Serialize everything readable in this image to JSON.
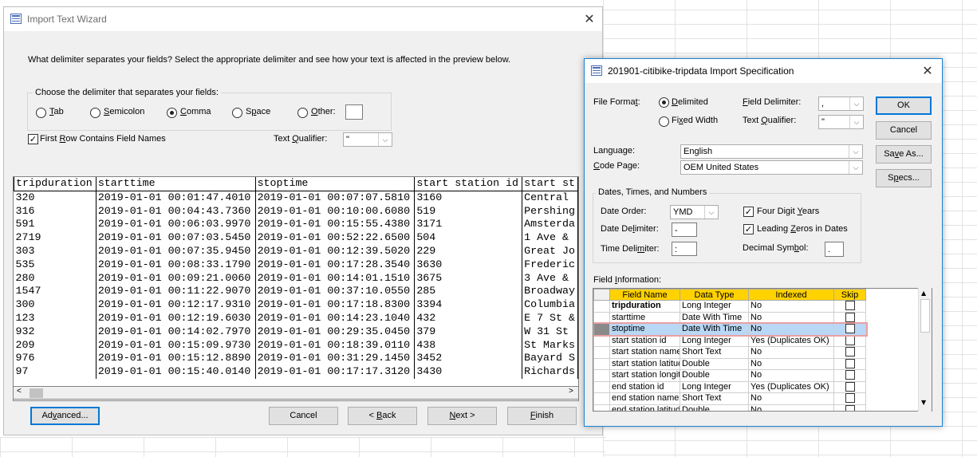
{
  "wizard": {
    "title": "Import Text Wizard",
    "prompt": "What delimiter separates your fields? Select the appropriate delimiter and see how your text is affected in the preview below.",
    "group_title": "Choose the delimiter that separates your fields:",
    "delimiters": [
      {
        "pre": "",
        "key": "T",
        "post": "ab",
        "selected": false
      },
      {
        "pre": "",
        "key": "S",
        "post": "emicolon",
        "selected": false
      },
      {
        "pre": "",
        "key": "C",
        "post": "omma",
        "selected": true
      },
      {
        "pre": "S",
        "key": "p",
        "post": "ace",
        "selected": false
      },
      {
        "pre": "",
        "key": "O",
        "post": "ther:",
        "selected": false
      }
    ],
    "first_row": {
      "pre": "First ",
      "key": "R",
      "post": "ow Contains Field Names",
      "checked": true
    },
    "text_qualifier": {
      "pre": "Text ",
      "key": "Q",
      "post": "ualifier:",
      "value": "\""
    },
    "preview": {
      "headers": [
        "tripduration",
        "starttime",
        "stoptime",
        "start station id",
        "start st"
      ],
      "rows": [
        [
          "320",
          "2019-01-01 00:01:47.4010",
          "2019-01-01 00:07:07.5810",
          "3160",
          "Central"
        ],
        [
          "316",
          "2019-01-01 00:04:43.7360",
          "2019-01-01 00:10:00.6080",
          "519",
          "Pershing"
        ],
        [
          "591",
          "2019-01-01 00:06:03.9970",
          "2019-01-01 00:15:55.4380",
          "3171",
          "Amsterda"
        ],
        [
          "2719",
          "2019-01-01 00:07:03.5450",
          "2019-01-01 00:52:22.6500",
          "504",
          "1 Ave &"
        ],
        [
          "303",
          "2019-01-01 00:07:35.9450",
          "2019-01-01 00:12:39.5020",
          "229",
          "Great Jo"
        ],
        [
          "535",
          "2019-01-01 00:08:33.1790",
          "2019-01-01 00:17:28.3540",
          "3630",
          "Frederic"
        ],
        [
          "280",
          "2019-01-01 00:09:21.0060",
          "2019-01-01 00:14:01.1510",
          "3675",
          "3 Ave &"
        ],
        [
          "1547",
          "2019-01-01 00:11:22.9070",
          "2019-01-01 00:37:10.0550",
          "285",
          "Broadway"
        ],
        [
          "300",
          "2019-01-01 00:12:17.9310",
          "2019-01-01 00:17:18.8300",
          "3394",
          "Columbia"
        ],
        [
          "123",
          "2019-01-01 00:12:19.6030",
          "2019-01-01 00:14:23.1040",
          "432",
          "E 7 St &"
        ],
        [
          "932",
          "2019-01-01 00:14:02.7970",
          "2019-01-01 00:29:35.0450",
          "379",
          "W 31 St"
        ],
        [
          "209",
          "2019-01-01 00:15:09.9730",
          "2019-01-01 00:18:39.0110",
          "438",
          "St Marks"
        ],
        [
          "976",
          "2019-01-01 00:15:12.8890",
          "2019-01-01 00:31:29.1450",
          "3452",
          "Bayard S"
        ],
        [
          "97",
          "2019-01-01 00:15:40.0140",
          "2019-01-01 00:17:17.3120",
          "3430",
          "Richards"
        ]
      ]
    },
    "buttons": {
      "advanced": {
        "pre": "Ad",
        "key": "v",
        "post": "anced..."
      },
      "cancel": {
        "pre": "Cancel",
        "key": "",
        "post": ""
      },
      "back": {
        "pre": "< ",
        "key": "B",
        "post": "ack"
      },
      "next": {
        "pre": "",
        "key": "N",
        "post": "ext >"
      },
      "finish": {
        "pre": "",
        "key": "F",
        "post": "inish"
      }
    }
  },
  "spec": {
    "title": "201901-citibike-tripdata Import Specification",
    "file_format": {
      "pre": "File Forma",
      "key": "t",
      "post": ":"
    },
    "delimited": {
      "pre": "",
      "key": "D",
      "post": "elimited",
      "selected": true
    },
    "fixed_width": {
      "pre": "Fi",
      "key": "x",
      "post": "ed Width",
      "selected": false
    },
    "field_delimiter": {
      "pre": "",
      "key": "F",
      "post": "ield Delimiter:",
      "value": ","
    },
    "text_qualifier": {
      "pre": "Text ",
      "key": "Q",
      "post": "ualifier:",
      "value": "\""
    },
    "language": {
      "label": "Language:",
      "value": "English"
    },
    "code_page": {
      "pre": "",
      "key": "C",
      "post": "ode Page:",
      "value": "OEM United States"
    },
    "dtn_group": "Dates, Times, and Numbers",
    "date_order": {
      "pre": "Date Order:",
      "key": "",
      "post": "",
      "value": "YMD"
    },
    "date_delimiter": {
      "pre": "Date De",
      "key": "l",
      "post": "imiter:",
      "value": "-"
    },
    "time_delimiter": {
      "pre": "Time Deli",
      "key": "m",
      "post": "iter:",
      "value": ":"
    },
    "four_digit_years": {
      "pre": "Four Digit ",
      "key": "Y",
      "post": "ears",
      "checked": true
    },
    "leading_zeros": {
      "pre": "Leading ",
      "key": "Z",
      "post": "eros in Dates",
      "checked": true
    },
    "decimal_symbol": {
      "pre": "Decimal Sym",
      "key": "b",
      "post": "ol:",
      "value": "."
    },
    "field_info": {
      "pre": "Field ",
      "key": "I",
      "post": "nformation:"
    },
    "columns": [
      "Field Name",
      "Data Type",
      "Indexed",
      "Skip"
    ],
    "fields": [
      {
        "name": "tripduration",
        "type": "Long Integer",
        "indexed": "No",
        "bold": true
      },
      {
        "name": "starttime",
        "type": "Date With Time",
        "indexed": "No"
      },
      {
        "name": "stoptime",
        "type": "Date With Time",
        "indexed": "No",
        "selected": true
      },
      {
        "name": "start station id",
        "type": "Long Integer",
        "indexed": "Yes (Duplicates OK)"
      },
      {
        "name": "start station name",
        "type": "Short Text",
        "indexed": "No"
      },
      {
        "name": "start station latitude",
        "type": "Double",
        "indexed": "No"
      },
      {
        "name": "start station longitude",
        "type": "Double",
        "indexed": "No"
      },
      {
        "name": "end station id",
        "type": "Long Integer",
        "indexed": "Yes (Duplicates OK)"
      },
      {
        "name": "end station name",
        "type": "Short Text",
        "indexed": "No"
      },
      {
        "name": "end station latitude",
        "type": "Double",
        "indexed": "No"
      }
    ],
    "buttons": {
      "ok": {
        "pre": "OK",
        "key": "",
        "post": ""
      },
      "cancel": {
        "pre": "Cancel",
        "key": "",
        "post": ""
      },
      "save_as": {
        "pre": "Sa",
        "key": "v",
        "post": "e As..."
      },
      "specs": {
        "pre": "S",
        "key": "p",
        "post": "ecs..."
      }
    }
  }
}
